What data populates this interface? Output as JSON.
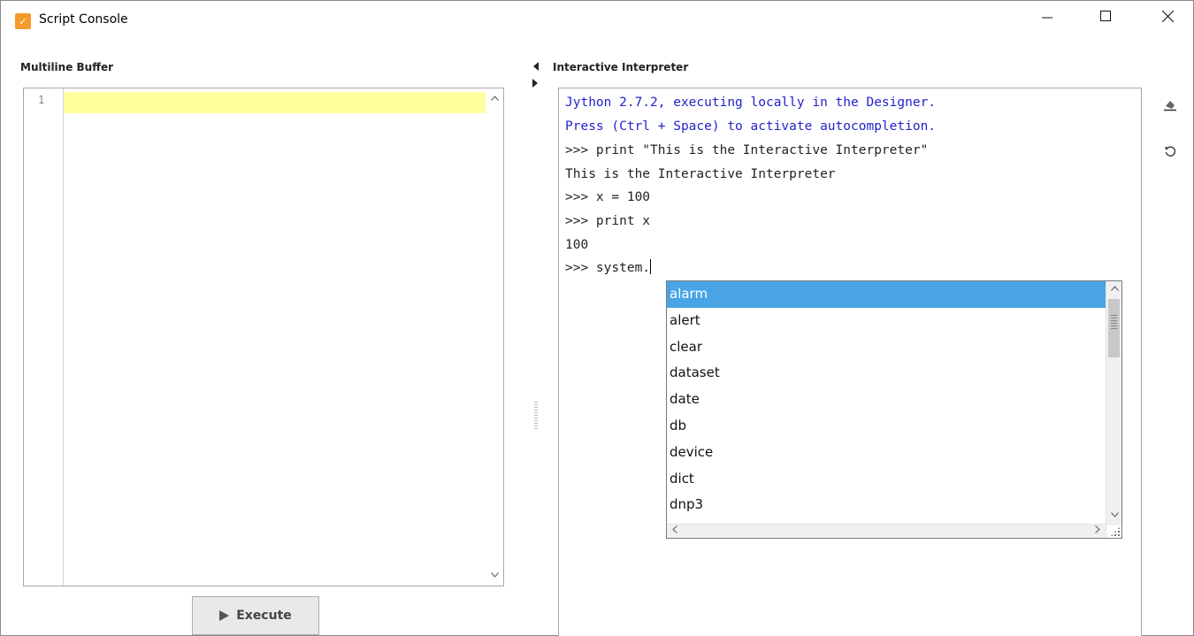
{
  "window": {
    "title": "Script Console",
    "controls": {
      "minimize": "minimize",
      "maximize": "maximize",
      "close": "close"
    }
  },
  "left_panel": {
    "label": "Multiline Buffer",
    "line_numbers": [
      "1"
    ],
    "execute_label": "Execute"
  },
  "right_panel": {
    "label": "Interactive Interpreter",
    "lines": [
      {
        "text": "Jython 2.7.2, executing locally in the Designer.",
        "style": "blue"
      },
      {
        "text": "Press (Ctrl + Space) to activate autocompletion.",
        "style": "blue"
      },
      {
        "text": ">>> print \"This is the Interactive Interpreter\"",
        "style": "dark"
      },
      {
        "text": "This is the Interactive Interpreter",
        "style": "dark"
      },
      {
        "text": ">>> x = 100",
        "style": "dark"
      },
      {
        "text": ">>> print x",
        "style": "dark"
      },
      {
        "text": "100",
        "style": "dark"
      },
      {
        "text": ">>> system.",
        "style": "dark"
      }
    ],
    "tools": [
      "eraser-icon",
      "reset-icon"
    ]
  },
  "autocomplete": {
    "selected_index": 0,
    "items": [
      "alarm",
      "alert",
      "clear",
      "dataset",
      "date",
      "db",
      "device",
      "dict",
      "dnp3"
    ]
  },
  "colors": {
    "app_icon": "#f39c2c",
    "current_line": "#ffff9e",
    "banner_text": "#2222cc",
    "selection": "#48a4e4"
  }
}
